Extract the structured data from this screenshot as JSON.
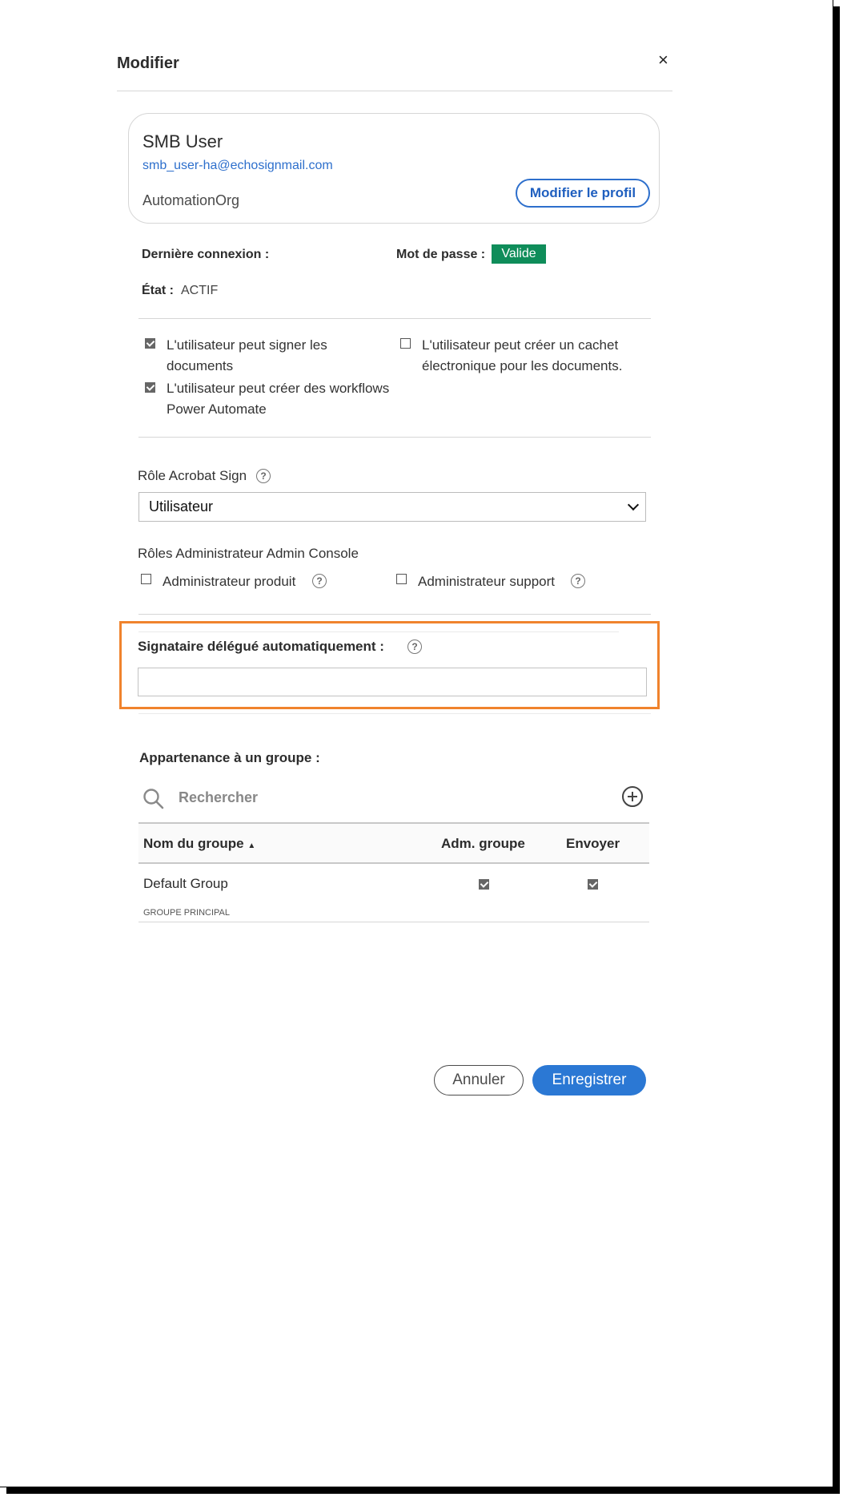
{
  "dialog": {
    "title": "Modifier",
    "close_symbol": "×"
  },
  "profile": {
    "name": "SMB User",
    "email": "smb_user-ha@echosignmail.com",
    "org": "AutomationOrg",
    "edit_button": "Modifier le profil"
  },
  "status": {
    "last_login_label": "Dernière connexion :",
    "password_label": "Mot de passe :",
    "password_badge": "Valide",
    "state_label": "État :",
    "state_value": "ACTIF"
  },
  "permissions": [
    {
      "line1": "L'utilisateur peut signer les",
      "line2": "documents",
      "checked": true
    },
    {
      "line1": "L'utilisateur peut créer des workflows",
      "line2": "Power Automate",
      "checked": true
    },
    {
      "line1": "L'utilisateur peut créer un cachet",
      "line2": "électronique pour les documents.",
      "checked": false
    }
  ],
  "role": {
    "label": "Rôle Acrobat Sign",
    "selected": "Utilisateur"
  },
  "admin_roles": {
    "label": "Rôles Administrateur Admin Console",
    "product_admin": "Administrateur produit",
    "support_admin": "Administrateur support"
  },
  "delegate": {
    "label": "Signataire délégué automatiquement :",
    "value": ""
  },
  "groups": {
    "label": "Appartenance à un groupe :",
    "search_placeholder": "Rechercher",
    "columns": {
      "name": "Nom du groupe",
      "sort_arrow": "▲",
      "admin": "Adm. groupe",
      "send": "Envoyer"
    },
    "rows": [
      {
        "name": "Default Group",
        "sub": "GROUPE PRINCIPAL",
        "admin": true,
        "send": true
      }
    ]
  },
  "footer": {
    "cancel": "Annuler",
    "save": "Enregistrer"
  },
  "colors": {
    "accent": "#2b78d4",
    "valid_badge": "#0f8d5a",
    "highlight": "#f0832d"
  }
}
